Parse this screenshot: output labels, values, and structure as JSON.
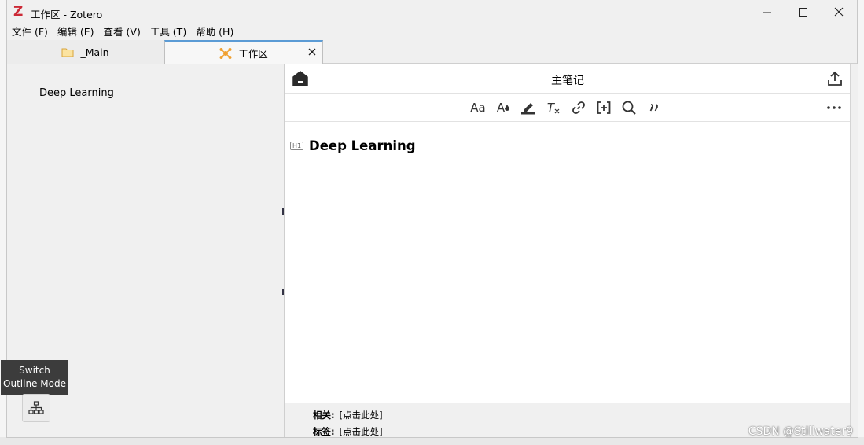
{
  "window": {
    "title": "工作区 - Zotero",
    "logo_letter": "Z",
    "controls": {
      "minimize": "—",
      "maximize": "☐",
      "close": "✕"
    }
  },
  "menubar": {
    "items": [
      "文件 (F)",
      "编辑 (E)",
      "查看 (V)",
      "工具 (T)",
      "帮助 (H)"
    ]
  },
  "tabs": [
    {
      "label": "_Main",
      "icon": "folder-icon"
    },
    {
      "label": "工作区",
      "icon": "workspace-icon",
      "close": "✕"
    }
  ],
  "outline": {
    "items": [
      "Deep Learning"
    ],
    "tooltip_line1": "Switch",
    "tooltip_line2": "Outline Mode"
  },
  "note": {
    "title": "主笔记",
    "heading_badge": "H1",
    "heading": "Deep Learning",
    "toolbar": {
      "font_size": "Aa",
      "text_color": "A",
      "clear_format": "T"
    },
    "footer": {
      "related_label": "相关:",
      "related_value": "[点击此处]",
      "tags_label": "标签:",
      "tags_value": "[点击此处]"
    }
  },
  "watermark": "CSDN @Stillwater9",
  "colors": {
    "accent": "#5b9bd5",
    "logo_red": "#cc2936",
    "workspace_icon": "#f0a030",
    "folder_icon": "#e8b84a"
  }
}
